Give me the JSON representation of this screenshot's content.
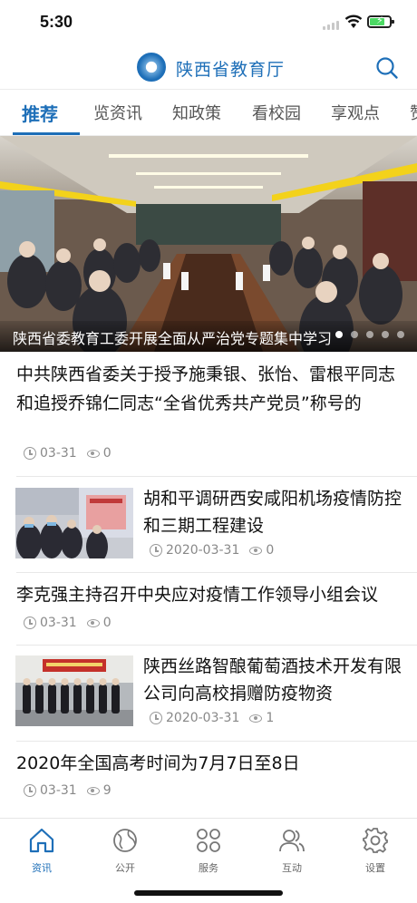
{
  "status_bar": {
    "time": "5:30"
  },
  "header": {
    "title": "陕西省教育厅",
    "logo": "shaanxi-education-emblem",
    "search_icon": "search-icon"
  },
  "tabs": [
    {
      "label": "推荐",
      "active": true
    },
    {
      "label": "览资讯",
      "active": false
    },
    {
      "label": "知政策",
      "active": false
    },
    {
      "label": "看校园",
      "active": false
    },
    {
      "label": "享观点",
      "active": false
    },
    {
      "label": "赞",
      "active": false
    }
  ],
  "banner": {
    "caption": "陕西省委教育工委开展全面从严治党专题集中学习",
    "slide_count": 5,
    "active_slide": 0
  },
  "news": [
    {
      "title": "中共陕西省委关于授予施秉银、张怡、雷根平同志和追授乔锦仁同志“全省优秀共产党员”称号的",
      "date": "03-31",
      "views": "0",
      "has_thumb": false
    },
    {
      "title": "胡和平调研西安咸阳机场疫情防控和三期工程建设",
      "date": "2020-03-31",
      "views": "0",
      "has_thumb": true
    },
    {
      "title": "李克强主持召开中央应对疫情工作领导小组会议",
      "date": "03-31",
      "views": "0",
      "has_thumb": false
    },
    {
      "title": "陕西丝路智酿葡萄酒技术开发有限公司向高校捐赠防疫物资",
      "date": "2020-03-31",
      "views": "1",
      "has_thumb": true
    },
    {
      "title": "2020年全国高考时间为7月7日至8日",
      "date": "03-31",
      "views": "9",
      "has_thumb": false
    }
  ],
  "bottom_nav": [
    {
      "label": "资讯",
      "icon": "home-icon",
      "active": true
    },
    {
      "label": "公开",
      "icon": "globe-icon",
      "active": false
    },
    {
      "label": "服务",
      "icon": "grid-icon",
      "active": false
    },
    {
      "label": "互动",
      "icon": "users-icon",
      "active": false
    },
    {
      "label": "设置",
      "icon": "gear-icon",
      "active": false
    }
  ],
  "colors": {
    "accent": "#1e6fb8",
    "text": "#111111",
    "meta": "#888888",
    "battery": "#4cd964"
  }
}
